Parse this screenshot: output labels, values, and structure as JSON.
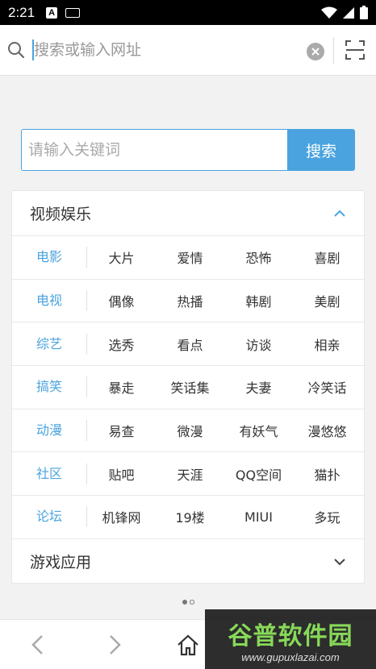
{
  "status_bar": {
    "time": "2:21",
    "a_badge": "A"
  },
  "url_bar": {
    "placeholder": "搜索或输入网址"
  },
  "search": {
    "placeholder": "请输入关键词",
    "button_label": "搜索"
  },
  "video_section": {
    "title": "视频娱乐",
    "rows": [
      {
        "category": "电影",
        "items": [
          "大片",
          "爱情",
          "恐怖",
          "喜剧"
        ]
      },
      {
        "category": "电视",
        "items": [
          "偶像",
          "热播",
          "韩剧",
          "美剧"
        ]
      },
      {
        "category": "综艺",
        "items": [
          "选秀",
          "看点",
          "访谈",
          "相亲"
        ]
      },
      {
        "category": "搞笑",
        "items": [
          "暴走",
          "笑话集",
          "夫妻",
          "冷笑话"
        ]
      },
      {
        "category": "动漫",
        "items": [
          "易查",
          "微漫",
          "有妖气",
          "漫悠悠"
        ]
      },
      {
        "category": "社区",
        "items": [
          "贴吧",
          "天涯",
          "QQ空间",
          "猫扑"
        ]
      },
      {
        "category": "论坛",
        "items": [
          "机锋网",
          "19楼",
          "MIUI",
          "多玩"
        ]
      }
    ]
  },
  "game_section": {
    "title": "游戏应用"
  },
  "watermark": {
    "title": "谷普软件园",
    "url": "www.gupuxlazai.com"
  },
  "colors": {
    "accent": "#4aa3df",
    "text": "#333333"
  }
}
